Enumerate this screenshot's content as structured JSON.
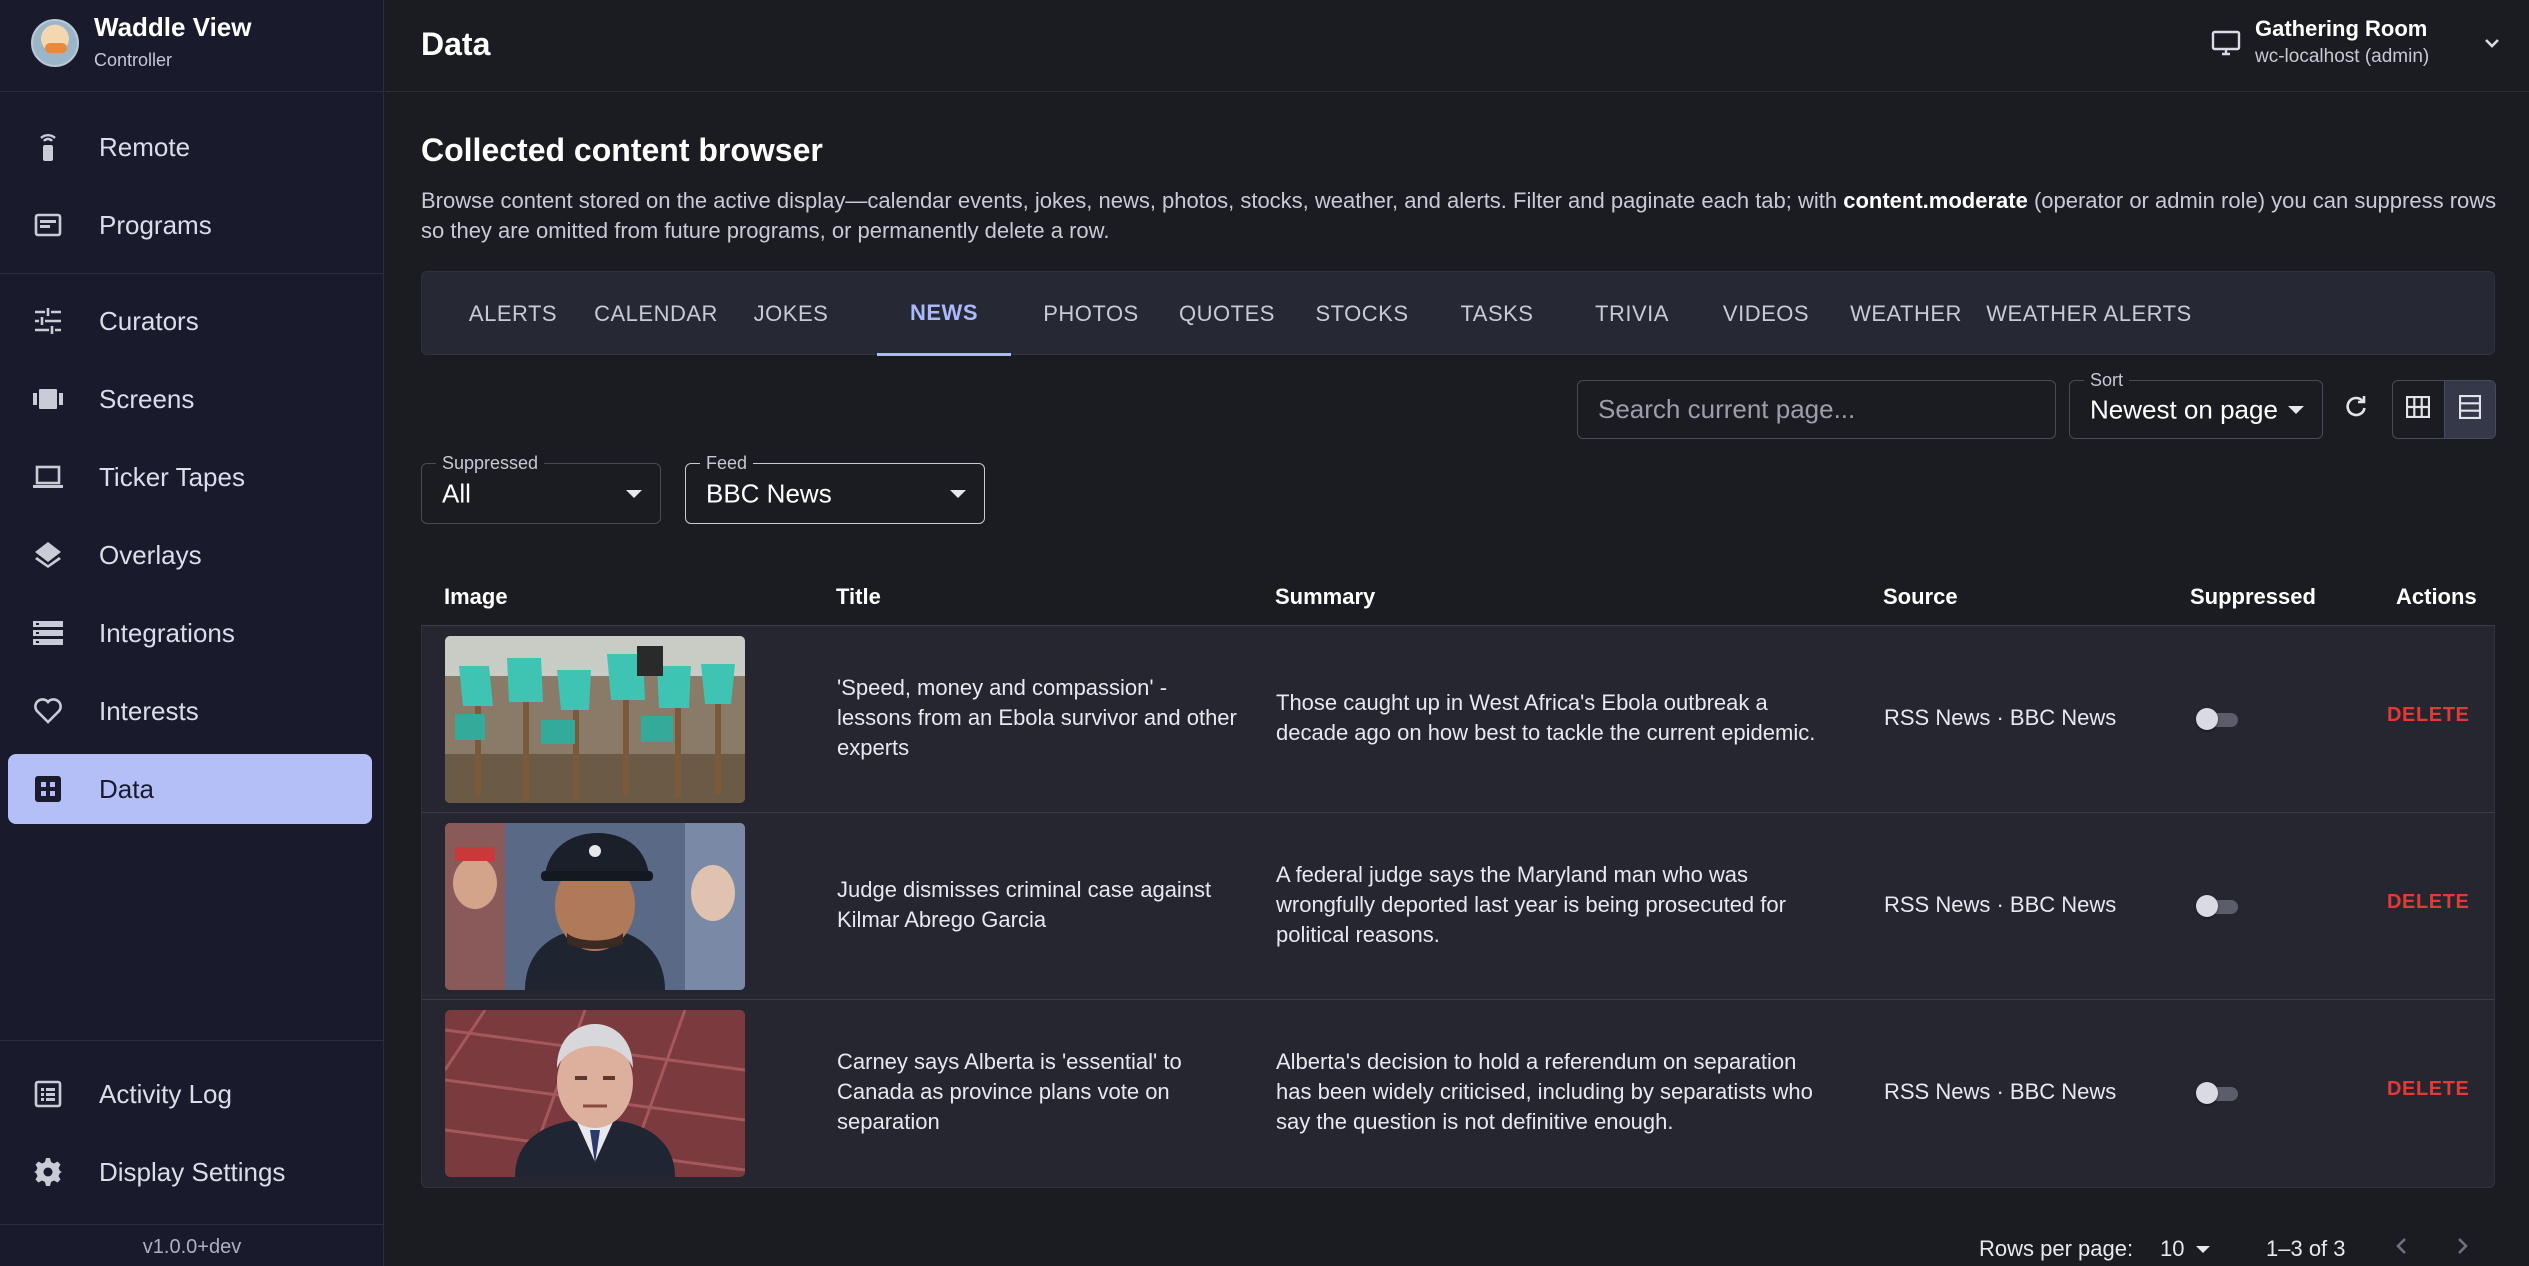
{
  "brand": {
    "name": "Waddle View",
    "subtitle": "Controller"
  },
  "nav": [
    {
      "label": "Remote",
      "icon": "remote-icon"
    },
    {
      "label": "Programs",
      "icon": "programs-icon"
    },
    {
      "label": "Curators",
      "icon": "sliders-icon"
    },
    {
      "label": "Screens",
      "icon": "screens-icon"
    },
    {
      "label": "Ticker Tapes",
      "icon": "laptop-icon"
    },
    {
      "label": "Overlays",
      "icon": "layers-icon"
    },
    {
      "label": "Integrations",
      "icon": "list-icon"
    },
    {
      "label": "Interests",
      "icon": "heart-icon"
    },
    {
      "label": "Data",
      "icon": "grid-icon",
      "active": true
    },
    {
      "label": "Activity Log",
      "icon": "log-icon"
    },
    {
      "label": "Display Settings",
      "icon": "gear-icon"
    }
  ],
  "version": "v1.0.0+dev",
  "header": {
    "title": "Data",
    "display": {
      "name": "Gathering Room",
      "host": "wc-localhost (admin)"
    }
  },
  "main": {
    "heading": "Collected content browser",
    "description_pre": "Browse content stored on the active display—calendar events, jokes, news, photos, stocks, weather, and alerts. Filter and paginate each tab; with ",
    "description_bold": "content.moderate",
    "description_post": " (operator or admin role) you can suppress rows so they are omitted from future programs, or permanently delete a row.",
    "tabs": [
      "ALERTS",
      "CALENDAR",
      "JOKES",
      "NEWS",
      "PHOTOS",
      "QUOTES",
      "STOCKS",
      "TASKS",
      "TRIVIA",
      "VIDEOS",
      "WEATHER",
      "WEATHER ALERTS"
    ],
    "active_tab": "NEWS",
    "search": {
      "placeholder": "Search current page...",
      "value": ""
    },
    "sort": {
      "label": "Sort",
      "value": "Newest on page"
    },
    "view_mode": "list",
    "filters": {
      "suppressed": {
        "label": "Suppressed",
        "value": "All"
      },
      "feed": {
        "label": "Feed",
        "value": "BBC News"
      }
    }
  },
  "table": {
    "columns": [
      "Image",
      "Title",
      "Summary",
      "Source",
      "Suppressed",
      "Actions"
    ],
    "rows": [
      {
        "title": "'Speed, money and compassion' - lessons from an Ebola survivor and other experts",
        "summary": "Those caught up in West Africa's Ebola outbreak a decade ago on how best to tackle the current epidemic.",
        "source": "RSS News · BBC News",
        "suppressed": false,
        "action": "DELETE",
        "image": "ebola-gloves-photo"
      },
      {
        "title": "Judge dismisses criminal case against Kilmar Abrego Garcia",
        "summary": "A federal judge says the Maryland man who was wrongfully deported last year is being prosecuted for political reasons.",
        "source": "RSS News · BBC News",
        "suppressed": false,
        "action": "DELETE",
        "image": "man-in-cap-photo"
      },
      {
        "title": "Carney says Alberta is 'essential' to Canada as province plans vote on separation",
        "summary": "Alberta's decision to hold a referendum on separation has been widely criticised, including by separatists who say the question is not definitive enough.",
        "source": "RSS News · BBC News",
        "suppressed": false,
        "action": "DELETE",
        "image": "carney-portrait-photo"
      }
    ]
  },
  "pagination": {
    "rows_per_page_label": "Rows per page:",
    "rows_per_page": "10",
    "range": "1–3 of 3"
  },
  "colors": {
    "accent": "#aab8ff",
    "active_nav": "#b4bff7",
    "danger": "#e53935",
    "background": "#1b1c22",
    "sidebar": "#191b2c"
  }
}
